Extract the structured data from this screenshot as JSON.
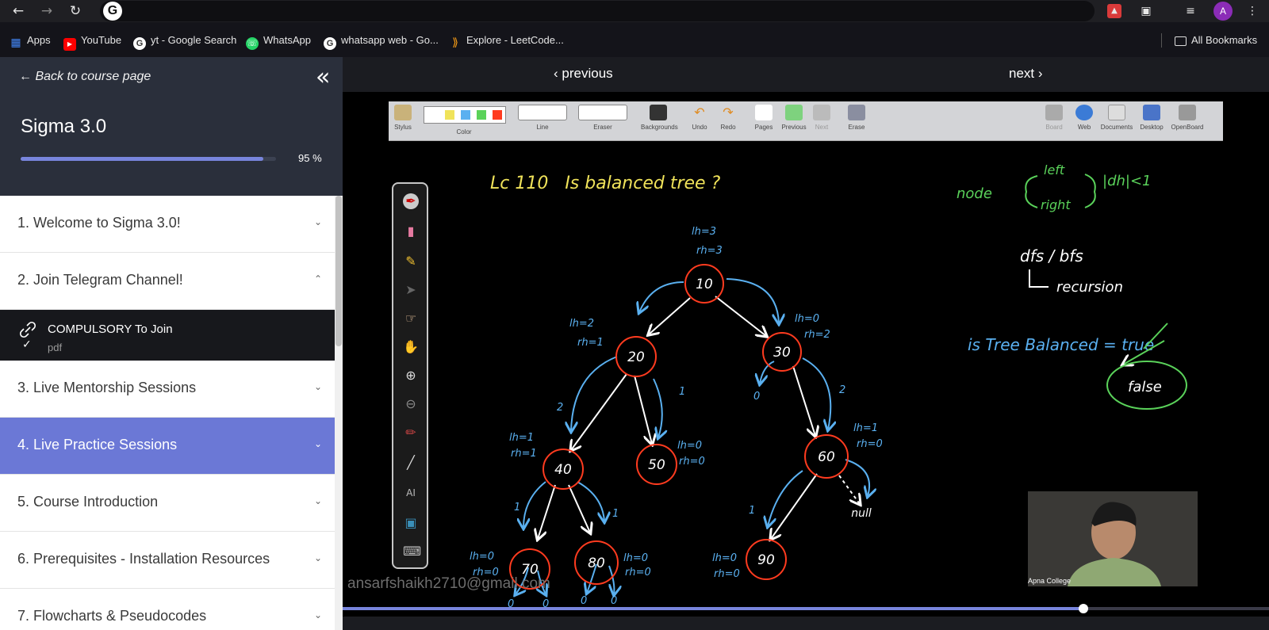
{
  "browser": {
    "back_icon": "arrow-left-icon",
    "forward_icon": "arrow-right-icon",
    "reload_icon": "reload-icon",
    "google_logo": "G",
    "avatar_letter": "A",
    "bookmarks": [
      {
        "label": "Apps",
        "icon": "apps-grid-icon",
        "color": "#4285f4"
      },
      {
        "label": "YouTube",
        "icon": "youtube-icon",
        "color": "#ff0000"
      },
      {
        "label": "yt - Google Search",
        "icon": "google-icon",
        "color": "#ffffff"
      },
      {
        "label": "WhatsApp",
        "icon": "whatsapp-icon",
        "color": "#25d366"
      },
      {
        "label": "whatsapp web - Go...",
        "icon": "google-icon",
        "color": "#ffffff"
      },
      {
        "label": "Explore - LeetCode...",
        "icon": "leetcode-icon",
        "color": "#ffa116"
      }
    ],
    "all_bookmarks": "All Bookmarks"
  },
  "sidebar": {
    "back_label": "Back to course page",
    "course_title": "Sigma 3.0",
    "progress_percent": 95,
    "progress_label": "95 %",
    "sections": [
      {
        "label": "1. Welcome to Sigma 3.0!",
        "expanded": false,
        "active": false
      },
      {
        "label": "2. Join Telegram Channel!",
        "expanded": true,
        "active": false
      },
      {
        "label": "3. Live Mentorship Sessions",
        "expanded": false,
        "active": false
      },
      {
        "label": "4. Live Practice Sessions",
        "expanded": false,
        "active": true
      },
      {
        "label": "5. Course Introduction",
        "expanded": false,
        "active": false
      },
      {
        "label": "6. Prerequisites - Installation Resources",
        "expanded": false,
        "active": false
      },
      {
        "label": "7. Flowcharts & Pseudocodes",
        "expanded": false,
        "active": false
      }
    ],
    "lesson": {
      "title": "COMPULSORY To Join",
      "type": "pdf",
      "completed": true
    }
  },
  "main": {
    "previous_label": "previous",
    "next_label": "next",
    "watermark": "ansarfshaikh2710@gmail.com",
    "webcam_label": "Apna College",
    "video_progress": 0.8
  },
  "toolbar": {
    "tools": [
      "Stylus",
      "Color",
      "Line",
      "Eraser",
      "Backgrounds",
      "Undo",
      "Redo",
      "Pages",
      "Previous",
      "Next",
      "Erase"
    ],
    "right_tools": [
      "Board",
      "Web",
      "Documents",
      "Desktop",
      "OpenBoard"
    ],
    "colors": [
      "#ffffff",
      "#f0e35a",
      "#5ab0f0",
      "#5ad25a",
      "#ff3b1f"
    ]
  },
  "whiteboard": {
    "title": "Lc 110   Is balanced tree ?",
    "rule_node": "node",
    "rule_left": "left",
    "rule_right": "right",
    "rule_diff": "|dh|<1",
    "dfs_bfs": "dfs / bfs",
    "recursion": "recursion",
    "is_balanced": "is Tree Balanced = true",
    "false_label": "false",
    "nodes": [
      "10",
      "20",
      "30",
      "40",
      "50",
      "60",
      "70",
      "80",
      "90"
    ],
    "null_label": "null",
    "ann_10": [
      "lh=3",
      "rh=3"
    ],
    "ann_20": [
      "lh=2",
      "rh=1"
    ],
    "ann_30": [
      "lh=0",
      "rh=2"
    ],
    "ann_40": [
      "lh=1",
      "rh=1"
    ],
    "ann_50": [
      "lh=0",
      "rh=0"
    ],
    "ann_60": [
      "lh=1",
      "rh=0"
    ],
    "ann_70": [
      "lh=0",
      "rh=0"
    ],
    "ann_80": [
      "lh=0",
      "rh=0"
    ],
    "ann_90": [
      "lh=0",
      "rh=0"
    ],
    "edge_labels": [
      "2",
      "1",
      "0",
      "2",
      "1",
      "1",
      "1",
      "0",
      "0",
      "0",
      "0"
    ]
  }
}
